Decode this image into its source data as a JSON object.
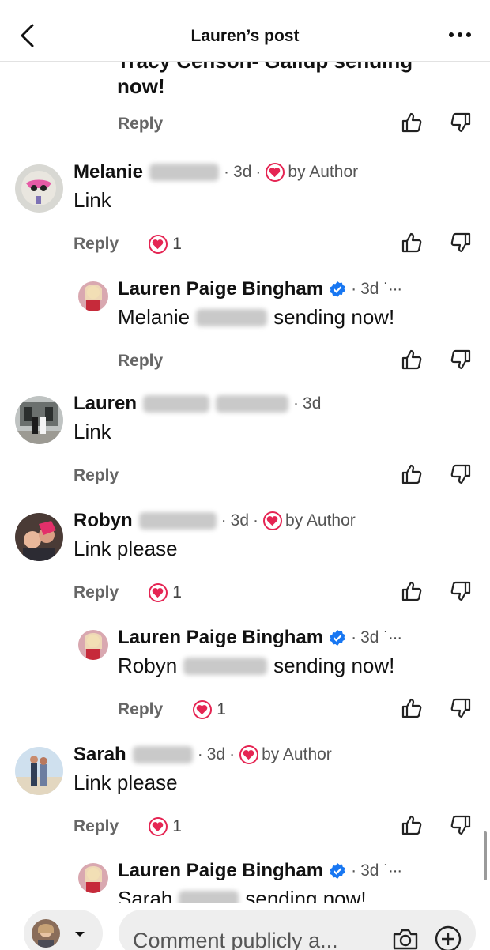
{
  "header": {
    "title": "Lauren’s post"
  },
  "fragment": {
    "line1": "Tracy Censon- Gallup sending",
    "line2": "now!"
  },
  "labels": {
    "reply": "Reply",
    "by_author": "by Author"
  },
  "comments": [
    {
      "name": "Melanie",
      "time": "3d",
      "text": "Link",
      "reactions": "1"
    },
    {
      "name": "Lauren Paige Bingham",
      "time": "3d",
      "text_before": "Melanie",
      "text_after": "sending now!"
    },
    {
      "name": "Lauren",
      "time": "3d",
      "text": "Link"
    },
    {
      "name": "Robyn",
      "time": "3d",
      "text": "Link please",
      "reactions": "1"
    },
    {
      "name": "Lauren Paige Bingham",
      "time": "3d",
      "text_before": "Robyn",
      "text_after": "sending now!",
      "reactions": "1"
    },
    {
      "name": "Sarah",
      "time": "3d",
      "text": "Link please",
      "reactions": "1"
    },
    {
      "name": "Lauren Paige Bingham",
      "time": "3d",
      "text_before": "Sarah",
      "text_after": "sending now!"
    }
  ],
  "composer": {
    "placeholder": "Comment publicly a..."
  },
  "colors": {
    "heart": "#e52553",
    "verified": "#1877f2"
  }
}
